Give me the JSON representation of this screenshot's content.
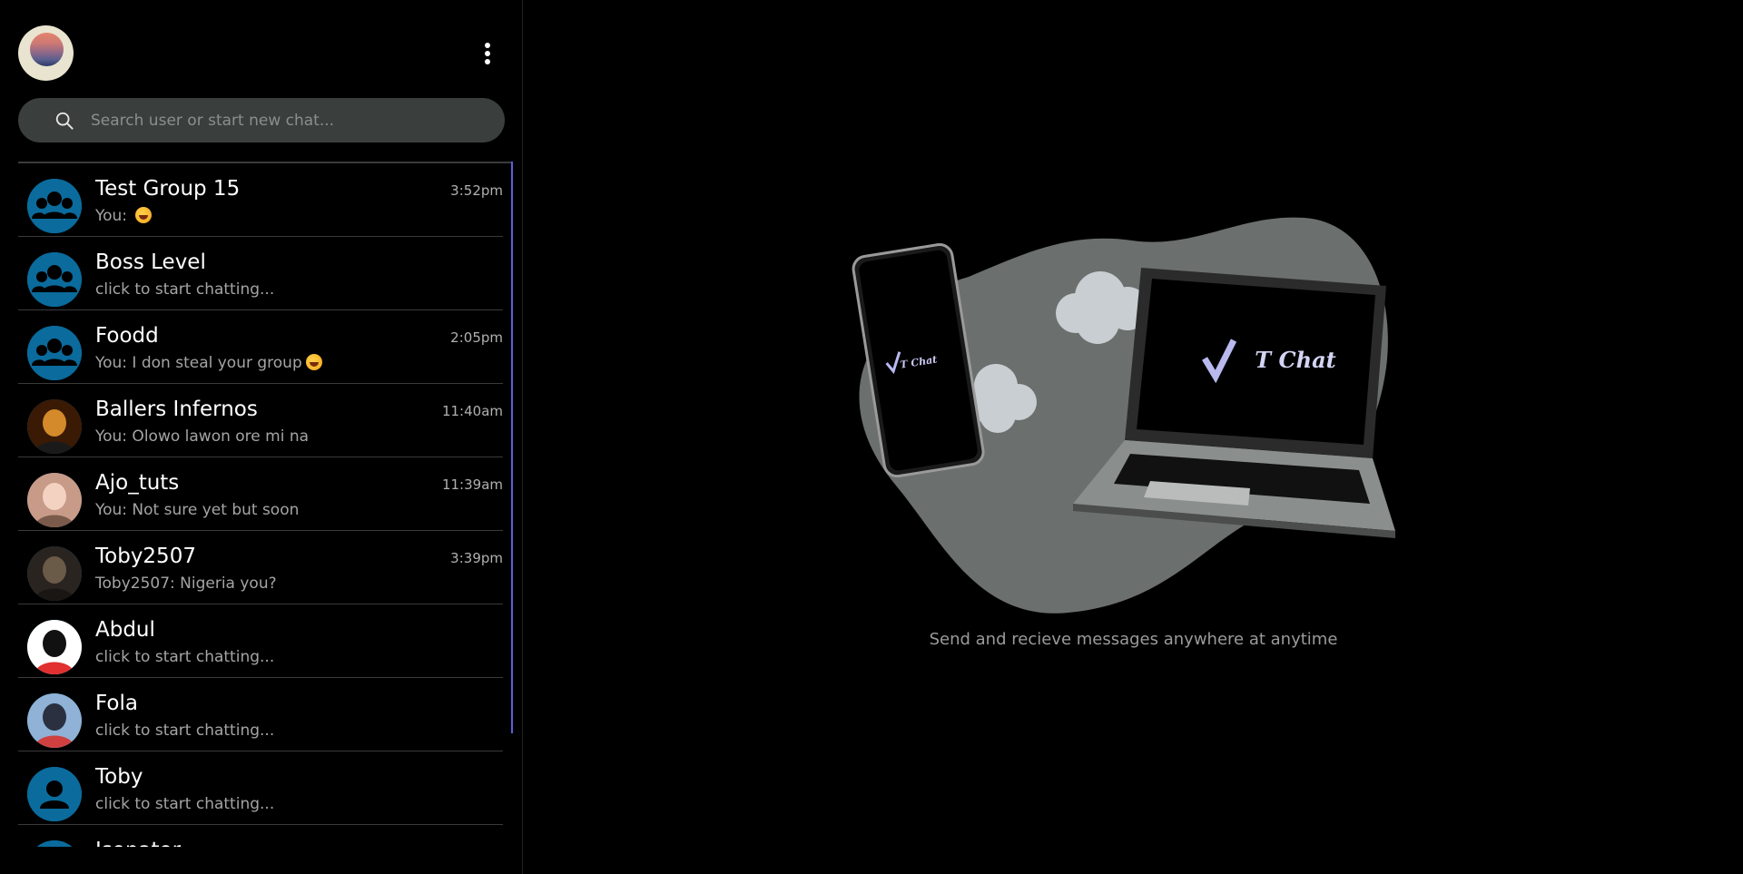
{
  "sidebar": {
    "search": {
      "placeholder": "Search user or start new chat..."
    },
    "chats": [
      {
        "name": "Test Group 15",
        "last_message": "You: ",
        "emoji": true,
        "time": "3:52pm",
        "avatar": "group-icon"
      },
      {
        "name": "Boss Level",
        "last_message": "click to start chatting...",
        "emoji": false,
        "time": "",
        "avatar": "group-icon"
      },
      {
        "name": "Foodd",
        "last_message": "You: I don steal your group",
        "emoji": true,
        "time": "2:05pm",
        "avatar": "group-icon"
      },
      {
        "name": "Ballers Infernos",
        "last_message": "You: Olowo lawon ore mi na",
        "emoji": false,
        "time": "11:40am",
        "avatar": "photo"
      },
      {
        "name": "Ajo_tuts",
        "last_message": "You: Not sure yet but soon",
        "emoji": false,
        "time": "11:39am",
        "avatar": "photo"
      },
      {
        "name": "Toby2507",
        "last_message": "Toby2507: Nigeria you?",
        "emoji": false,
        "time": "3:39pm",
        "avatar": "photo"
      },
      {
        "name": "Abdul",
        "last_message": "click to start chatting...",
        "emoji": false,
        "time": "",
        "avatar": "photo"
      },
      {
        "name": "Fola",
        "last_message": "click to start chatting...",
        "emoji": false,
        "time": "",
        "avatar": "photo"
      },
      {
        "name": "Toby",
        "last_message": "click to start chatting...",
        "emoji": false,
        "time": "",
        "avatar": "user-icon"
      },
      {
        "name": "Isonator",
        "last_message": "",
        "emoji": false,
        "time": "",
        "avatar": "user-icon"
      }
    ]
  },
  "main": {
    "logo_text": "T Chat",
    "caption": "Send and recieve messages anywhere at anytime"
  },
  "colors": {
    "background": "#000000",
    "search_bg": "#3a3f3d",
    "avatar_blue": "#0a6b9c",
    "scrollbar": "#5a5fe0",
    "blob": "#6b6f6d"
  }
}
